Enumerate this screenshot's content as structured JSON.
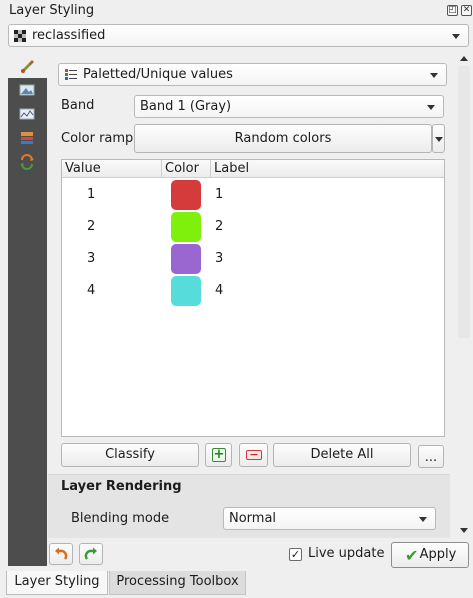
{
  "panel": {
    "title": "Layer Styling",
    "float_glyph": "◰",
    "close_glyph": "✕"
  },
  "layer_select": {
    "value": "reclassified",
    "icon": "raster-layer-icon"
  },
  "sidebar": {
    "tabs": [
      {
        "icon": "symbology-brush-icon"
      },
      {
        "icon": "transparency-icon"
      },
      {
        "icon": "histogram-icon"
      },
      {
        "icon": "rendering-icon"
      },
      {
        "icon": "history-icon"
      }
    ]
  },
  "renderer": {
    "value": "Paletted/Unique values"
  },
  "band": {
    "label": "Band",
    "value": "Band 1 (Gray)"
  },
  "color_ramp": {
    "label": "Color ramp",
    "value": "Random colors"
  },
  "classes_table": {
    "headers": [
      "Value",
      "Color",
      "Label"
    ],
    "rows": [
      {
        "value": "1",
        "color": "#d63b3b",
        "label": "1"
      },
      {
        "value": "2",
        "color": "#7fef0c",
        "label": "2"
      },
      {
        "value": "3",
        "color": "#9a66cf",
        "label": "3"
      },
      {
        "value": "4",
        "color": "#57dcdc",
        "label": "4"
      }
    ]
  },
  "actions": {
    "classify": "Classify",
    "delete_all": "Delete All",
    "more": "...",
    "add_glyph": "+",
    "remove_glyph": "−"
  },
  "layer_rendering": {
    "heading": "Layer Rendering",
    "blending_label": "Blending mode",
    "blending_value": "Normal"
  },
  "footer": {
    "live_update_label": "Live update",
    "live_update_checked": true,
    "check_glyph": "✓",
    "apply_label": "Apply",
    "apply_glyph": "✔"
  },
  "bottom_tabs": [
    "Layer Styling",
    "Processing Toolbox"
  ]
}
